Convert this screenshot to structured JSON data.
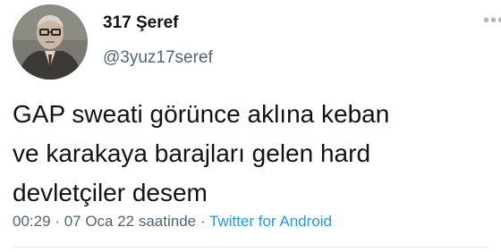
{
  "author": {
    "display_name": "317 Şeref",
    "handle": "@3yuz17seref",
    "avatar_icon": "profile-photo-icon"
  },
  "tweet": {
    "lines": [
      "GAP sweati görünce aklına keban",
      "ve karakaya barajları gelen hard",
      "devletçiler desem"
    ],
    "time": "00:29",
    "separator": "·",
    "date": "07 Oca 22 saatinde",
    "source": "Twitter for Android"
  },
  "colors": {
    "text": "#0f1419",
    "secondary": "#536471",
    "link": "#1d9bf0"
  }
}
